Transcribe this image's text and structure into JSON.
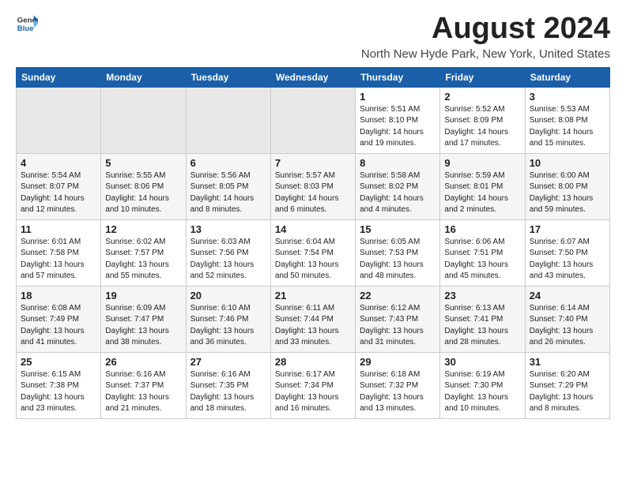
{
  "header": {
    "logo_general": "General",
    "logo_blue": "Blue",
    "title": "August 2024",
    "subtitle": "North New Hyde Park, New York, United States"
  },
  "days_of_week": [
    "Sunday",
    "Monday",
    "Tuesday",
    "Wednesday",
    "Thursday",
    "Friday",
    "Saturday"
  ],
  "weeks": [
    [
      {
        "day": "",
        "content": ""
      },
      {
        "day": "",
        "content": ""
      },
      {
        "day": "",
        "content": ""
      },
      {
        "day": "",
        "content": ""
      },
      {
        "day": "1",
        "content": "Sunrise: 5:51 AM\nSunset: 8:10 PM\nDaylight: 14 hours\nand 19 minutes."
      },
      {
        "day": "2",
        "content": "Sunrise: 5:52 AM\nSunset: 8:09 PM\nDaylight: 14 hours\nand 17 minutes."
      },
      {
        "day": "3",
        "content": "Sunrise: 5:53 AM\nSunset: 8:08 PM\nDaylight: 14 hours\nand 15 minutes."
      }
    ],
    [
      {
        "day": "4",
        "content": "Sunrise: 5:54 AM\nSunset: 8:07 PM\nDaylight: 14 hours\nand 12 minutes."
      },
      {
        "day": "5",
        "content": "Sunrise: 5:55 AM\nSunset: 8:06 PM\nDaylight: 14 hours\nand 10 minutes."
      },
      {
        "day": "6",
        "content": "Sunrise: 5:56 AM\nSunset: 8:05 PM\nDaylight: 14 hours\nand 8 minutes."
      },
      {
        "day": "7",
        "content": "Sunrise: 5:57 AM\nSunset: 8:03 PM\nDaylight: 14 hours\nand 6 minutes."
      },
      {
        "day": "8",
        "content": "Sunrise: 5:58 AM\nSunset: 8:02 PM\nDaylight: 14 hours\nand 4 minutes."
      },
      {
        "day": "9",
        "content": "Sunrise: 5:59 AM\nSunset: 8:01 PM\nDaylight: 14 hours\nand 2 minutes."
      },
      {
        "day": "10",
        "content": "Sunrise: 6:00 AM\nSunset: 8:00 PM\nDaylight: 13 hours\nand 59 minutes."
      }
    ],
    [
      {
        "day": "11",
        "content": "Sunrise: 6:01 AM\nSunset: 7:58 PM\nDaylight: 13 hours\nand 57 minutes."
      },
      {
        "day": "12",
        "content": "Sunrise: 6:02 AM\nSunset: 7:57 PM\nDaylight: 13 hours\nand 55 minutes."
      },
      {
        "day": "13",
        "content": "Sunrise: 6:03 AM\nSunset: 7:56 PM\nDaylight: 13 hours\nand 52 minutes."
      },
      {
        "day": "14",
        "content": "Sunrise: 6:04 AM\nSunset: 7:54 PM\nDaylight: 13 hours\nand 50 minutes."
      },
      {
        "day": "15",
        "content": "Sunrise: 6:05 AM\nSunset: 7:53 PM\nDaylight: 13 hours\nand 48 minutes."
      },
      {
        "day": "16",
        "content": "Sunrise: 6:06 AM\nSunset: 7:51 PM\nDaylight: 13 hours\nand 45 minutes."
      },
      {
        "day": "17",
        "content": "Sunrise: 6:07 AM\nSunset: 7:50 PM\nDaylight: 13 hours\nand 43 minutes."
      }
    ],
    [
      {
        "day": "18",
        "content": "Sunrise: 6:08 AM\nSunset: 7:49 PM\nDaylight: 13 hours\nand 41 minutes."
      },
      {
        "day": "19",
        "content": "Sunrise: 6:09 AM\nSunset: 7:47 PM\nDaylight: 13 hours\nand 38 minutes."
      },
      {
        "day": "20",
        "content": "Sunrise: 6:10 AM\nSunset: 7:46 PM\nDaylight: 13 hours\nand 36 minutes."
      },
      {
        "day": "21",
        "content": "Sunrise: 6:11 AM\nSunset: 7:44 PM\nDaylight: 13 hours\nand 33 minutes."
      },
      {
        "day": "22",
        "content": "Sunrise: 6:12 AM\nSunset: 7:43 PM\nDaylight: 13 hours\nand 31 minutes."
      },
      {
        "day": "23",
        "content": "Sunrise: 6:13 AM\nSunset: 7:41 PM\nDaylight: 13 hours\nand 28 minutes."
      },
      {
        "day": "24",
        "content": "Sunrise: 6:14 AM\nSunset: 7:40 PM\nDaylight: 13 hours\nand 26 minutes."
      }
    ],
    [
      {
        "day": "25",
        "content": "Sunrise: 6:15 AM\nSunset: 7:38 PM\nDaylight: 13 hours\nand 23 minutes."
      },
      {
        "day": "26",
        "content": "Sunrise: 6:16 AM\nSunset: 7:37 PM\nDaylight: 13 hours\nand 21 minutes."
      },
      {
        "day": "27",
        "content": "Sunrise: 6:16 AM\nSunset: 7:35 PM\nDaylight: 13 hours\nand 18 minutes."
      },
      {
        "day": "28",
        "content": "Sunrise: 6:17 AM\nSunset: 7:34 PM\nDaylight: 13 hours\nand 16 minutes."
      },
      {
        "day": "29",
        "content": "Sunrise: 6:18 AM\nSunset: 7:32 PM\nDaylight: 13 hours\nand 13 minutes."
      },
      {
        "day": "30",
        "content": "Sunrise: 6:19 AM\nSunset: 7:30 PM\nDaylight: 13 hours\nand 10 minutes."
      },
      {
        "day": "31",
        "content": "Sunrise: 6:20 AM\nSunset: 7:29 PM\nDaylight: 13 hours\nand 8 minutes."
      }
    ]
  ]
}
